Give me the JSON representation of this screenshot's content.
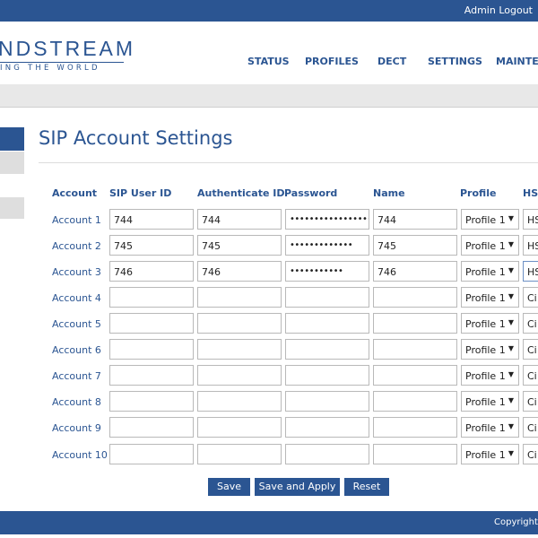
{
  "topbar": {
    "admin": "Admin",
    "logout": "Logout"
  },
  "logo": {
    "brand": "NDSTREAM",
    "tagline": "ING THE WORLD"
  },
  "nav": {
    "items": [
      "STATUS",
      "PROFILES",
      "DECT",
      "SETTINGS",
      "MAINTEN"
    ]
  },
  "page": {
    "title": "SIP Account Settings"
  },
  "columns": {
    "account": "Account",
    "sip_user_id": "SIP User ID",
    "auth_id": "Authenticate ID",
    "password": "Password",
    "name": "Name",
    "profile": "Profile",
    "hs": "HS"
  },
  "rows": [
    {
      "label": "Account 1",
      "sip": "744",
      "auth": "744",
      "pw": "•••••••••••••••••••••••",
      "name": "744",
      "profile": "Profile 1",
      "hs": "HS"
    },
    {
      "label": "Account 2",
      "sip": "745",
      "auth": "745",
      "pw": "•••••••••••••",
      "name": "745",
      "profile": "Profile 1",
      "hs": "HS"
    },
    {
      "label": "Account 3",
      "sip": "746",
      "auth": "746",
      "pw": "•••••••••••",
      "name": "746",
      "profile": "Profile 1",
      "hs": "HS"
    },
    {
      "label": "Account 4",
      "sip": "",
      "auth": "",
      "pw": "",
      "name": "",
      "profile": "Profile 1",
      "hs": "Ci"
    },
    {
      "label": "Account 5",
      "sip": "",
      "auth": "",
      "pw": "",
      "name": "",
      "profile": "Profile 1",
      "hs": "Ci"
    },
    {
      "label": "Account 6",
      "sip": "",
      "auth": "",
      "pw": "",
      "name": "",
      "profile": "Profile 1",
      "hs": "Ci"
    },
    {
      "label": "Account 7",
      "sip": "",
      "auth": "",
      "pw": "",
      "name": "",
      "profile": "Profile 1",
      "hs": "Ci"
    },
    {
      "label": "Account 8",
      "sip": "",
      "auth": "",
      "pw": "",
      "name": "",
      "profile": "Profile 1",
      "hs": "Ci"
    },
    {
      "label": "Account 9",
      "sip": "",
      "auth": "",
      "pw": "",
      "name": "",
      "profile": "Profile 1",
      "hs": "Ci"
    },
    {
      "label": "Account 10",
      "sip": "",
      "auth": "",
      "pw": "",
      "name": "",
      "profile": "Profile 1",
      "hs": "Ci"
    }
  ],
  "buttons": {
    "save": "Save",
    "save_apply": "Save and Apply",
    "reset": "Reset"
  },
  "footer": {
    "copyright": "Copyright ©"
  },
  "colors": {
    "brand": "#2b5592"
  }
}
